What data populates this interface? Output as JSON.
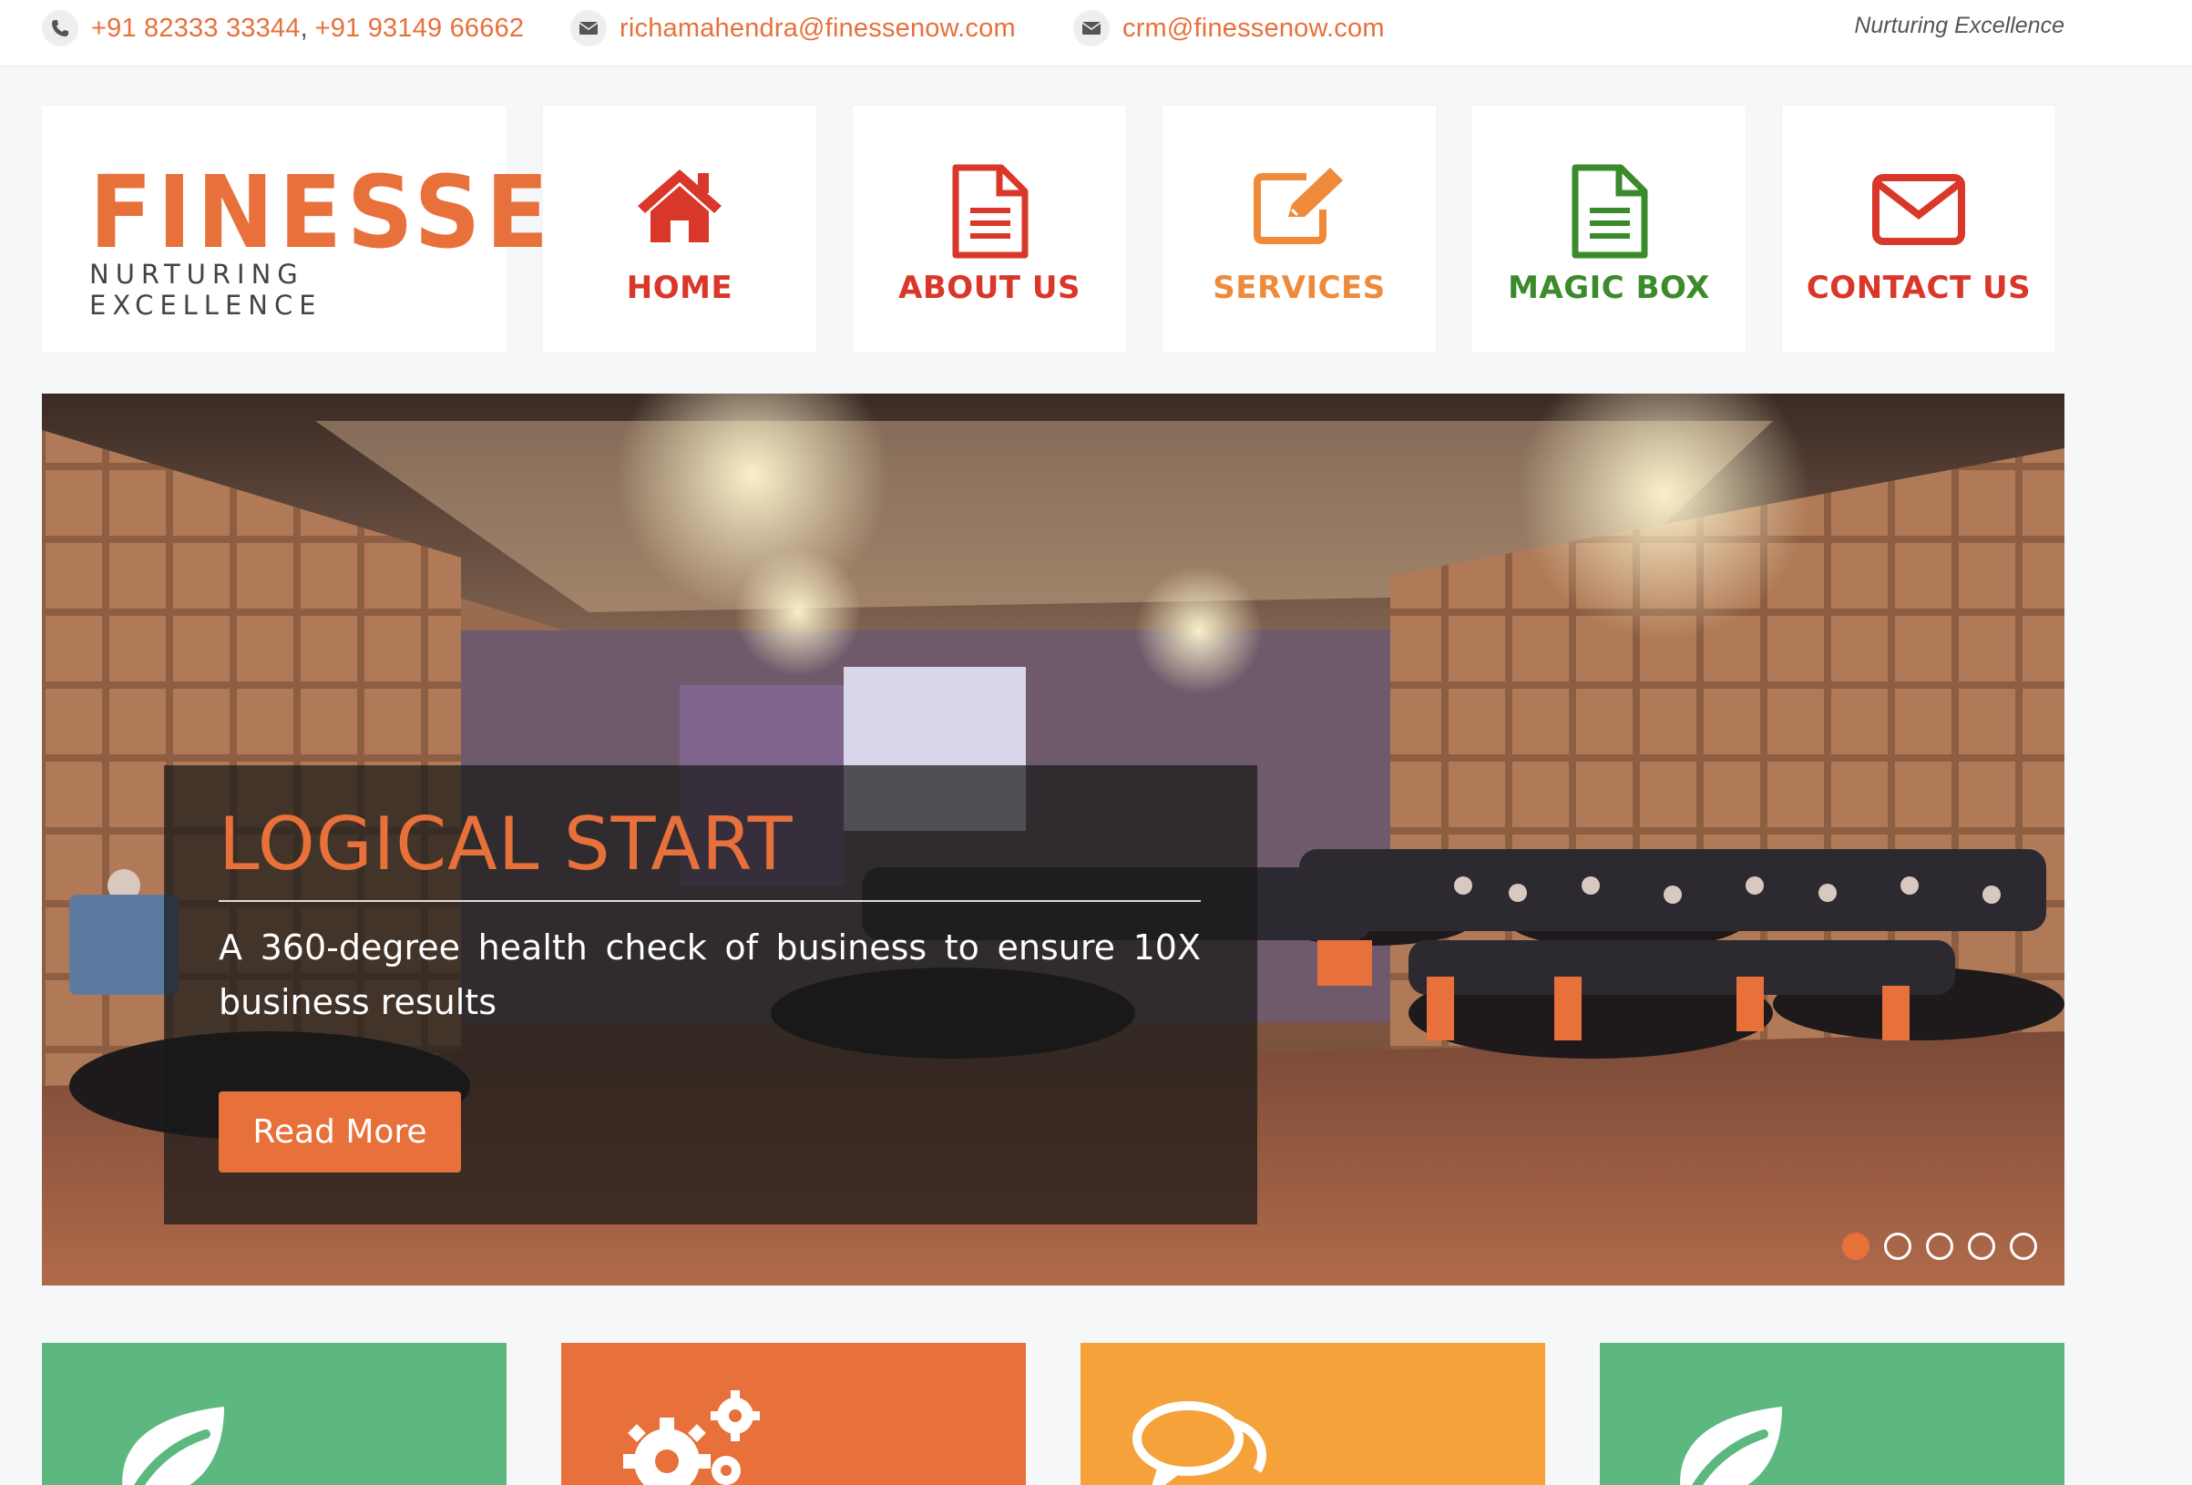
{
  "topbar": {
    "phone_icon": "phone-icon",
    "phone1": "+91 82333 33344",
    "phone_sep": ",",
    "phone2": "+91 93149 66662",
    "email_icon": "envelope-icon",
    "email1": "richamahendra@finessenow.com",
    "email2": "crm@finessenow.com",
    "tagline": "Nurturing Excellence"
  },
  "logo": {
    "word": "FINESSE",
    "subtitle": "NURTURING EXCELLENCE"
  },
  "nav": [
    {
      "label": "HOME",
      "icon": "home-icon",
      "color": "#d9372a"
    },
    {
      "label": "ABOUT US",
      "icon": "document-icon",
      "color": "#d9372a"
    },
    {
      "label": "SERVICES",
      "icon": "edit-icon",
      "color": "#ee8a3a"
    },
    {
      "label": "MAGIC BOX",
      "icon": "document-icon",
      "color": "#3b8a2b"
    },
    {
      "label": "CONTACT US",
      "icon": "envelope-icon",
      "color": "#d9372a"
    }
  ],
  "hero": {
    "title": "LOGICAL START",
    "text": "A 360-degree health check of business to ensure 10X business results",
    "button": "Read More",
    "slides": 5,
    "active_slide": 1
  },
  "cards": [
    {
      "icon": "leaf-icon",
      "color": "#5cb87f"
    },
    {
      "icon": "gears-icon",
      "color": "#e8703a"
    },
    {
      "icon": "chat-bubbles-icon",
      "color": "#f5a23a"
    },
    {
      "icon": "leaf-icon",
      "color": "#5cb87f"
    }
  ],
  "colors": {
    "accent": "#e8703a",
    "background": "#f6f7f9"
  }
}
